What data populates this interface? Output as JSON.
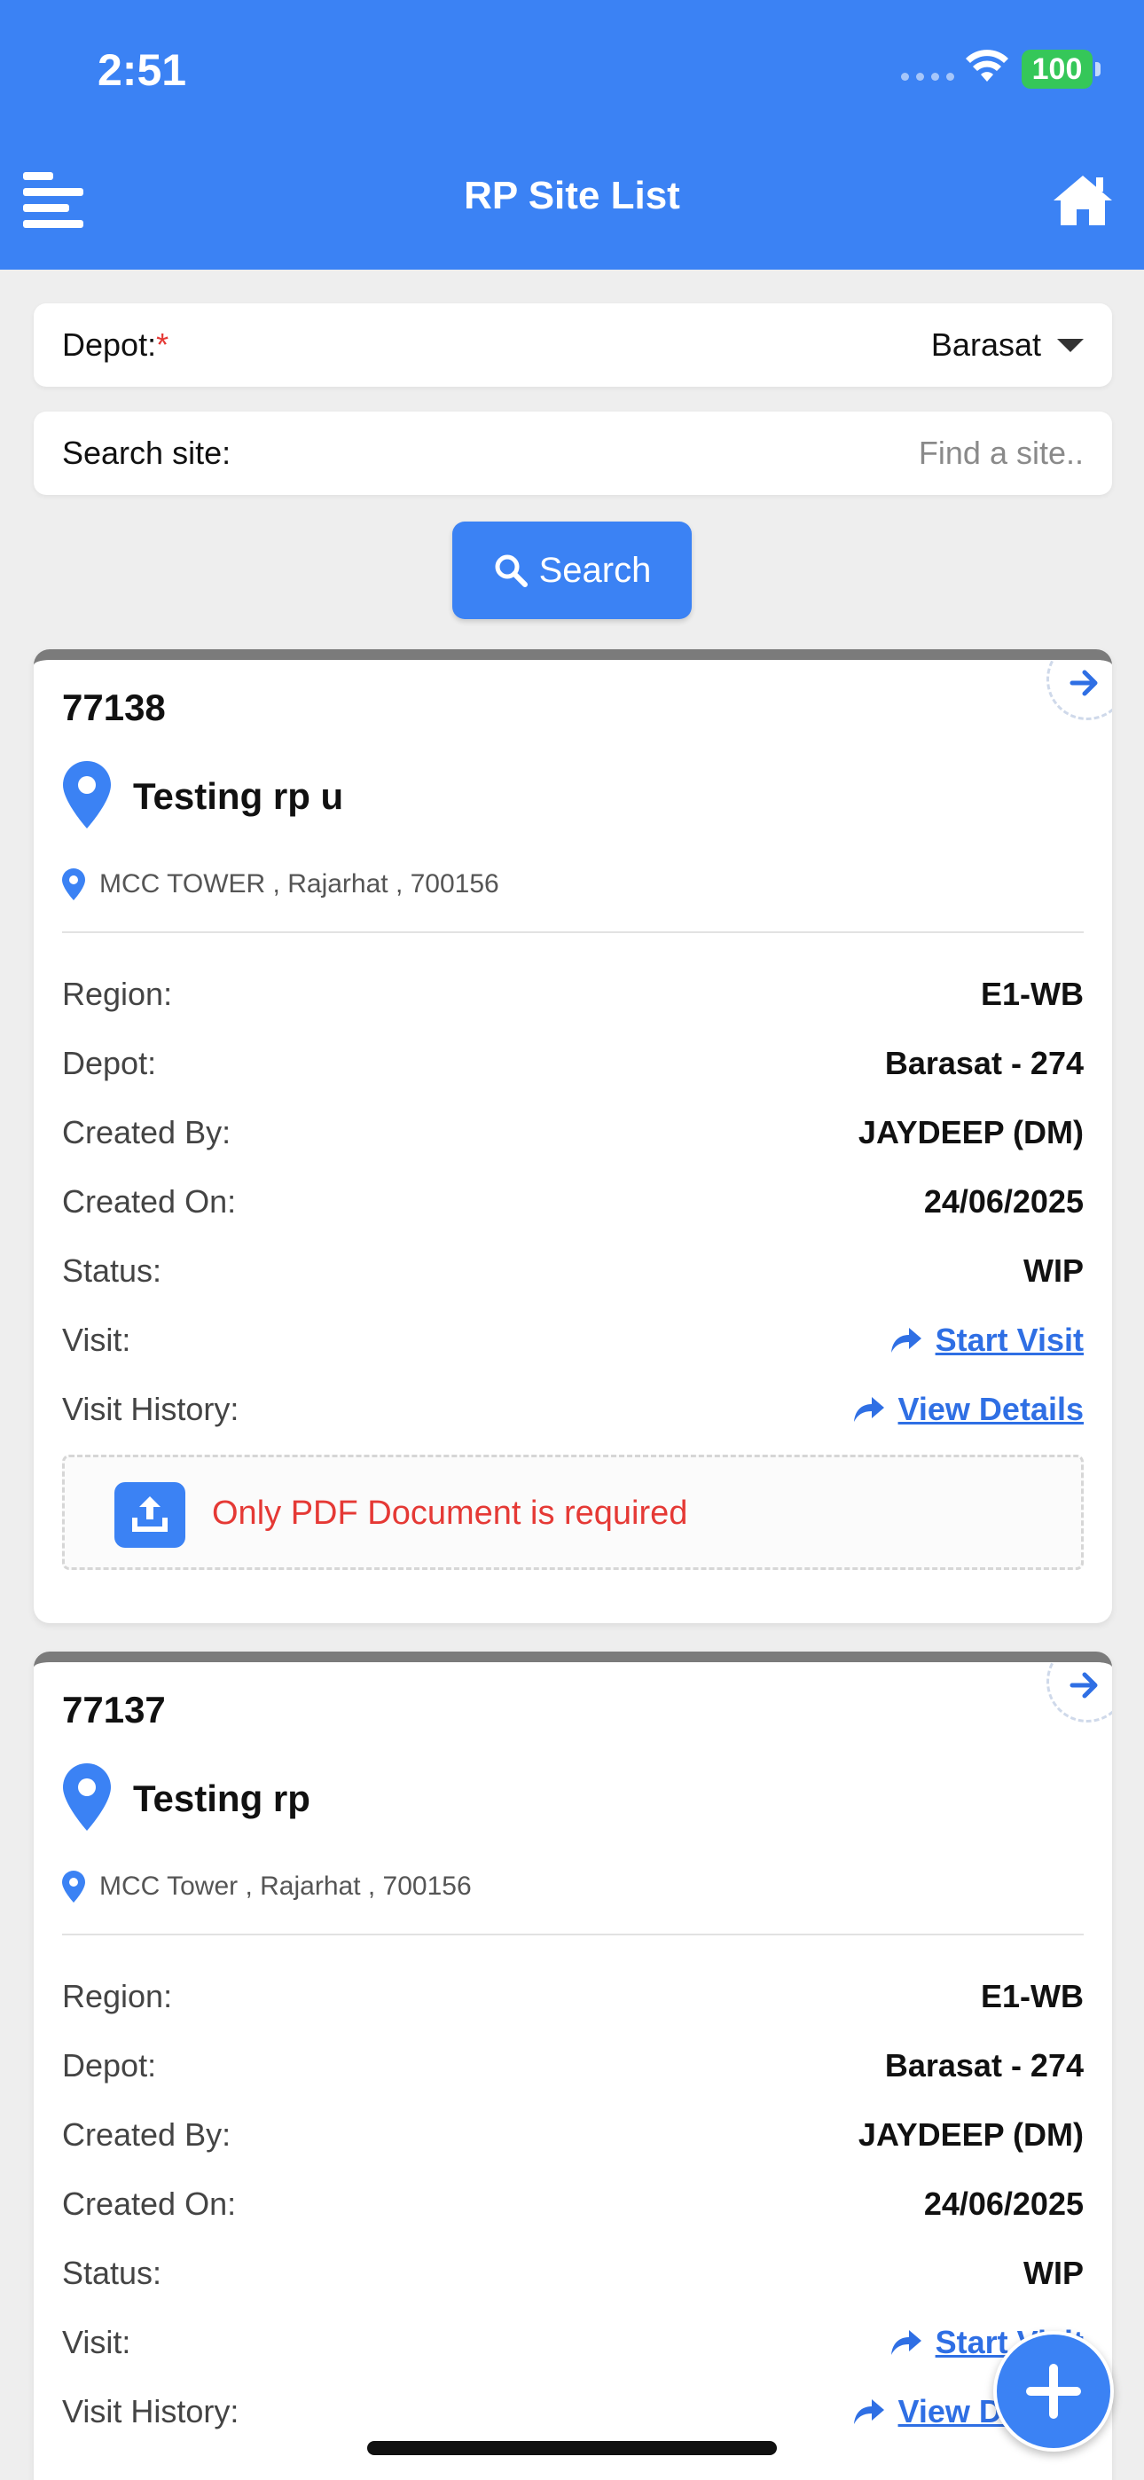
{
  "status_bar": {
    "time": "2:51",
    "battery": "100"
  },
  "header": {
    "title": "RP Site List"
  },
  "filters": {
    "depot_label": "Depot:",
    "required_mark": "*",
    "depot_value": "Barasat",
    "search_label": "Search site:",
    "search_placeholder": "Find a site.."
  },
  "search_button": {
    "label": "Search"
  },
  "row_labels": {
    "region": "Region:",
    "depot": "Depot:",
    "created_by": "Created By:",
    "created_on": "Created On:",
    "status": "Status:",
    "visit": "Visit:",
    "visit_history": "Visit History:"
  },
  "cards": [
    {
      "id": "77138",
      "name": "Testing rp u",
      "address": "MCC TOWER , Rajarhat , 700156",
      "region": "E1-WB",
      "depot": "Barasat - 274",
      "created_by": "JAYDEEP (DM)",
      "created_on": "24/06/2025",
      "status": "WIP",
      "visit_link": "Start Visit",
      "history_link": "View Details",
      "upload_note": "Only PDF Document is required"
    },
    {
      "id": "77137",
      "name": "Testing rp",
      "address": "MCC Tower , Rajarhat , 700156",
      "region": "E1-WB",
      "depot": "Barasat - 274",
      "created_by": "JAYDEEP (DM)",
      "created_on": "24/06/2025",
      "status": "WIP",
      "visit_link": "Start Visit",
      "history_link": "View Details"
    }
  ],
  "colors": {
    "primary": "#3b82f4",
    "error": "#e53935",
    "link": "#2f6fe4"
  }
}
